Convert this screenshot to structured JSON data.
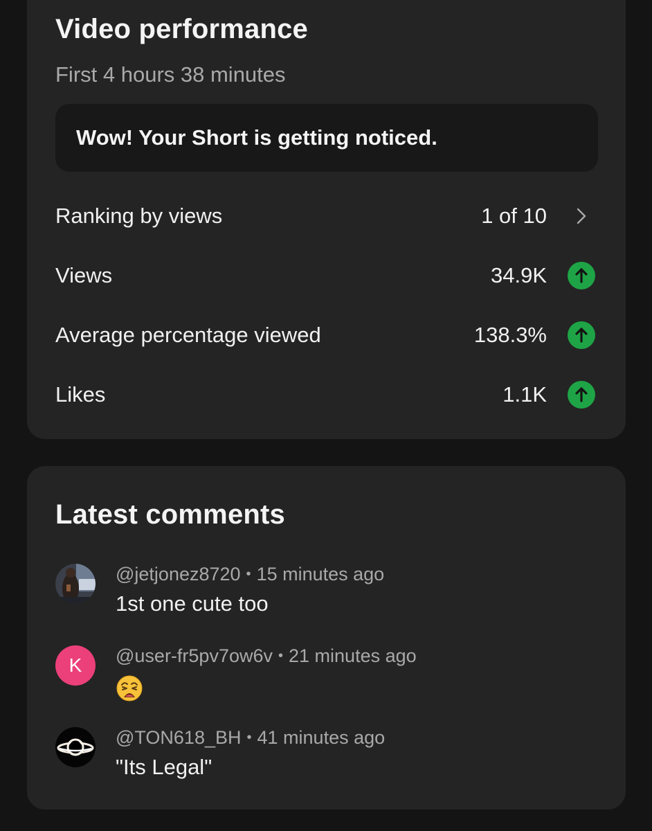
{
  "performance": {
    "title": "Video performance",
    "subtitle": "First 4 hours 38 minutes",
    "notice": "Wow! Your Short is getting noticed.",
    "metrics": [
      {
        "label": "Ranking by views",
        "value": "1 of 10",
        "icon": "chevron-right-icon"
      },
      {
        "label": "Views",
        "value": "34.9K",
        "icon": "arrow-up-circle-icon"
      },
      {
        "label": "Average percentage viewed",
        "value": "138.3%",
        "icon": "arrow-up-circle-icon"
      },
      {
        "label": "Likes",
        "value": "1.1K",
        "icon": "arrow-up-circle-icon"
      }
    ],
    "colors": {
      "up": "#1ea446",
      "card": "#242424",
      "background": "#141414"
    }
  },
  "comments": {
    "title": "Latest comments",
    "separator": "•",
    "items": [
      {
        "author": "@jetjonez8720",
        "time": "15 minutes ago",
        "text": "1st one cute too",
        "avatar": "photo-avatar"
      },
      {
        "author": "@user-fr5pv7ow6v",
        "time": "21 minutes ago",
        "text": "😩",
        "avatar": "letter-avatar",
        "avatar_letter": "K",
        "avatar_color": "#ec407a"
      },
      {
        "author": "@TON618_BH",
        "time": "41 minutes ago",
        "text": "\"Its Legal\"",
        "avatar": "black-hole-avatar"
      }
    ]
  }
}
